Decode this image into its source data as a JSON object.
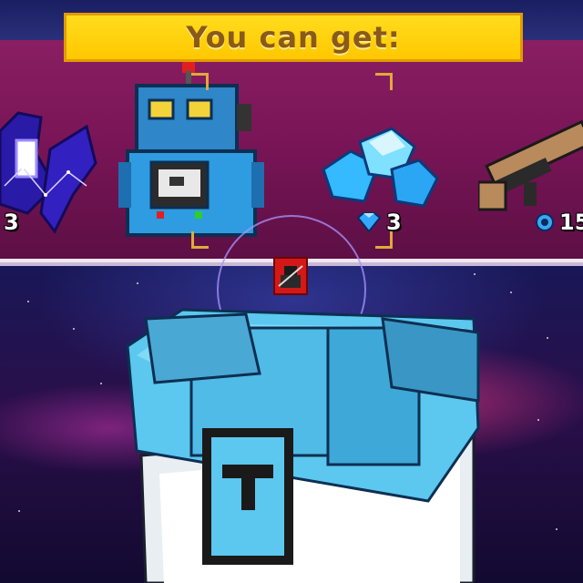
{
  "banner": {
    "title": "You can get:"
  },
  "rewards": [
    {
      "name": "constellation-wings",
      "count": "3"
    },
    {
      "name": "robot-pet",
      "count": ""
    },
    {
      "name": "gems",
      "count": "3",
      "currency_icon": "gem-icon"
    },
    {
      "name": "rifle",
      "count": "15",
      "currency_icon": "gear-icon"
    }
  ],
  "colors": {
    "banner": "#ffc800",
    "panel": "#7a1557",
    "chest": "#4fc3ec"
  }
}
